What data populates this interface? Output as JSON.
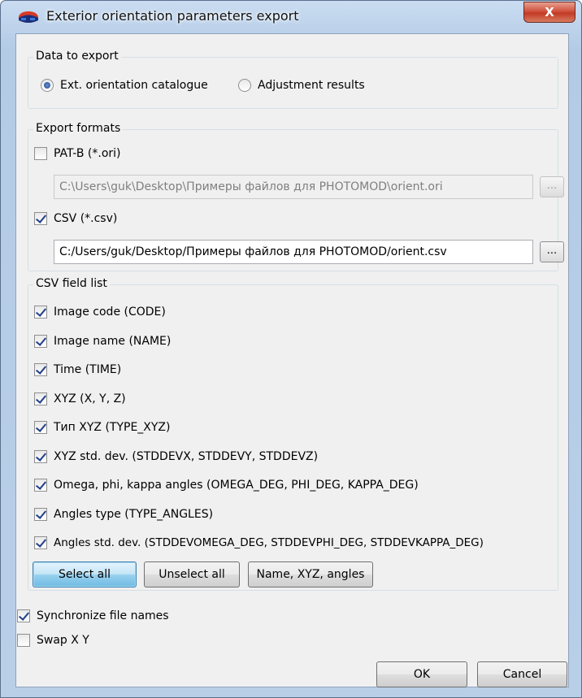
{
  "window": {
    "title": "Exterior orientation parameters export",
    "close_label": "X"
  },
  "data_to_export": {
    "title": "Data to export",
    "options": [
      {
        "label": "Ext. orientation catalogue",
        "selected": true
      },
      {
        "label": "Adjustment results",
        "selected": false
      }
    ]
  },
  "export_formats": {
    "title": "Export formats",
    "patb": {
      "label": "PAT-B (*.ori)",
      "checked": false,
      "path": "C:\\Users\\guk\\Desktop\\Примеры файлов для PHOTOMOD\\orient.ori",
      "browse_label": "..."
    },
    "csv": {
      "label": "CSV (*.csv)",
      "checked": true,
      "path": "C:/Users/guk/Desktop/Примеры файлов для PHOTOMOD/orient.csv",
      "browse_label": "..."
    }
  },
  "csv_fields": {
    "title": "CSV field list",
    "items": [
      {
        "label": "Image code (CODE)",
        "checked": true
      },
      {
        "label": "Image name (NAME)",
        "checked": true
      },
      {
        "label": "Time (TIME)",
        "checked": true
      },
      {
        "label": "XYZ (X, Y, Z)",
        "checked": true
      },
      {
        "label": "Тип XYZ (TYPE_XYZ)",
        "checked": true
      },
      {
        "label": "XYZ std. dev. (STDDEVX, STDDEVY, STDDEVZ)",
        "checked": true
      },
      {
        "label": "Omega, phi, kappa angles (OMEGA_DEG, PHI_DEG, KAPPA_DEG)",
        "checked": true
      },
      {
        "label": "Angles type (TYPE_ANGLES)",
        "checked": true
      },
      {
        "label": "Angles std. dev. (STDDEVOMEGA_DEG, STDDEVPHI_DEG, STDDEVKAPPA_DEG)",
        "checked": true
      }
    ],
    "select_all_label": "Select all",
    "unselect_all_label": "Unselect all",
    "preset_label": "Name, XYZ, angles"
  },
  "options": {
    "sync_label": "Synchronize file names",
    "sync_checked": true,
    "swap_label": "Swap X Y",
    "swap_checked": false
  },
  "footer": {
    "ok_label": "OK",
    "cancel_label": "Cancel"
  }
}
